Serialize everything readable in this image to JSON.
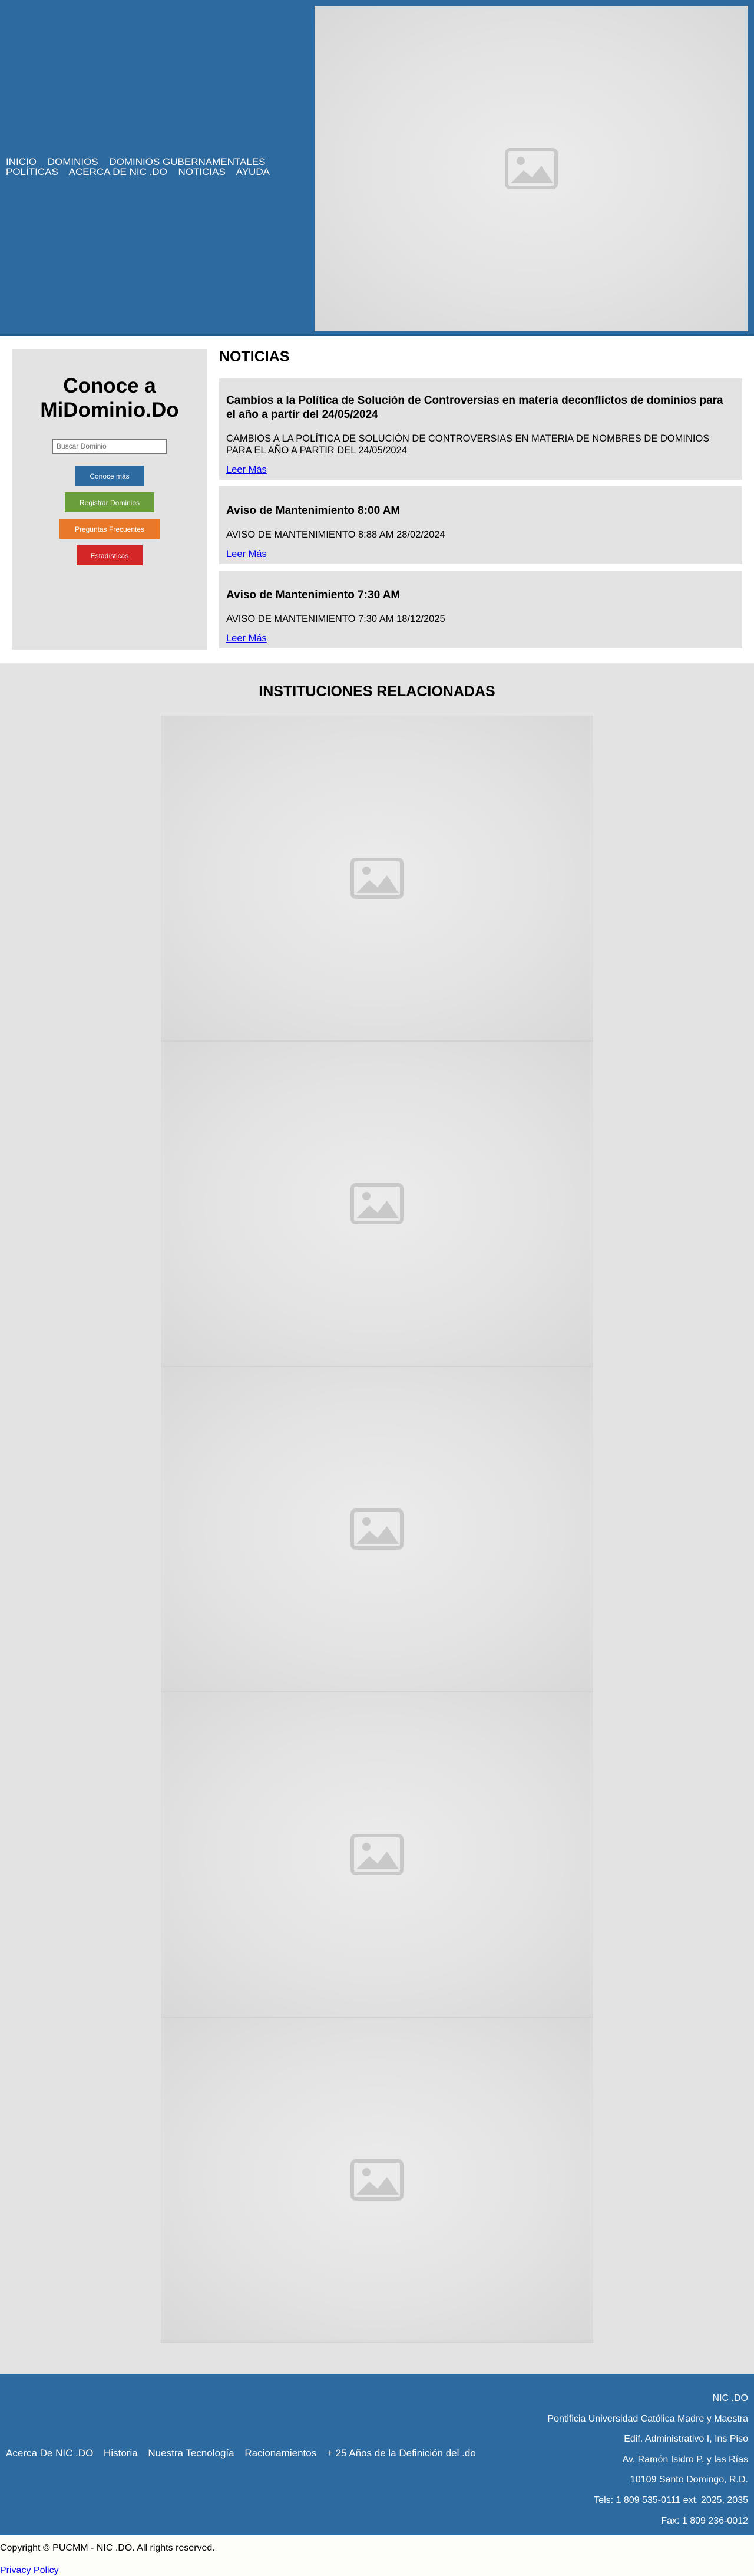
{
  "nav": {
    "items": [
      "INICIO",
      "DOMINIOS",
      "DOMINIOS GUBERNAMENTALES",
      "POLÍTICAS",
      "ACERCA DE NIC .DO",
      "NOTICIAS",
      "AYUDA"
    ]
  },
  "sidebar": {
    "title": "Conoce a MiDominio.Do",
    "search_placeholder": "Buscar Dominio",
    "buttons": [
      "Conoce más",
      "Registrar Dominios",
      "Preguntas Frecuentes",
      "Estadísticas"
    ],
    "button_colors": [
      "#2d6aa0",
      "#6a9e3a",
      "#e97829",
      "#d42527"
    ]
  },
  "news": {
    "heading": "NOTICIAS",
    "items": [
      {
        "title": "Cambios a la Política de Solución de Controversias en materia deconflictos de dominios para el año a partir del 24/05/2024",
        "body": "CAMBIOS A LA POLÍTICA DE SOLUCIÓN DE CONTROVERSIAS EN MATERIA DE NOMBRES DE DOMINIOS PARA EL AÑO A PARTIR DEL 24/05/2024",
        "link": "Leer Más"
      },
      {
        "title": "Aviso de Mantenimiento 8:00 AM",
        "body": "AVISO DE MANTENIMIENTO 8:88 AM 28/02/2024",
        "link": "Leer Más"
      },
      {
        "title": "Aviso de Mantenimiento 7:30 AM",
        "body": "AVISO DE MANTENIMIENTO 7:30 AM 18/12/2025",
        "link": "Leer Más"
      }
    ]
  },
  "institutions": {
    "heading": "INSTITUCIONES RELACIONADAS",
    "logo_count": 5
  },
  "footer": {
    "links": [
      "Acerca De NIC .DO",
      "Historia",
      "Nuestra Tecnología",
      "Racionamientos",
      "+ 25 Años de la Definición del .do"
    ],
    "address": [
      "NIC .DO",
      "Pontificia Universidad Católica Madre y Maestra",
      "Edif. Administrativo I, Ins Piso",
      "Av. Ramón Isidro P. y las Rías",
      "10109 Santo Domingo, R.D.",
      "Tels: 1 809 535-0111 ext. 2025, 2035",
      "Fax: 1 809 236-0012"
    ]
  },
  "bottom": {
    "copyright": "Copyright © PUCMM - NIC .DO. All rights reserved.",
    "privacy": "Privacy Policy"
  },
  "colors": {
    "brand_blue": "#2d6aa0",
    "panel_gray": "#e3e3e3"
  }
}
